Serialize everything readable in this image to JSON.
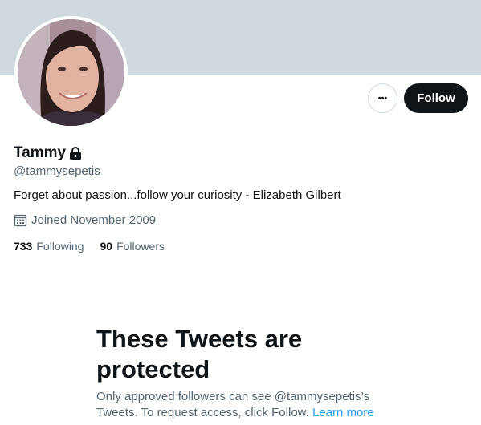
{
  "header": {
    "more_label": "•••",
    "follow_label": "Follow"
  },
  "profile": {
    "name": "Tammy",
    "handle": "@tammysepetis",
    "bio": "Forget about passion...follow your curiosity - Elizabeth Gilbert",
    "joined": "Joined November 2009",
    "following_count": "733",
    "following_label": "Following",
    "followers_count": "90",
    "followers_label": "Followers"
  },
  "protected_notice": {
    "title": "These Tweets are protected",
    "description": "Only approved followers can see @tammysepetis’s Tweets. To request access, click Follow.",
    "link_label": "Learn more"
  },
  "icons": {
    "lock": "lock-icon",
    "calendar": "calendar-icon",
    "more": "more-icon"
  },
  "colors": {
    "banner": "#cfd9de",
    "primary_text": "#0f1419",
    "secondary_text": "#536471",
    "link": "#1d9bf0",
    "follow_button": "#0f1419"
  }
}
